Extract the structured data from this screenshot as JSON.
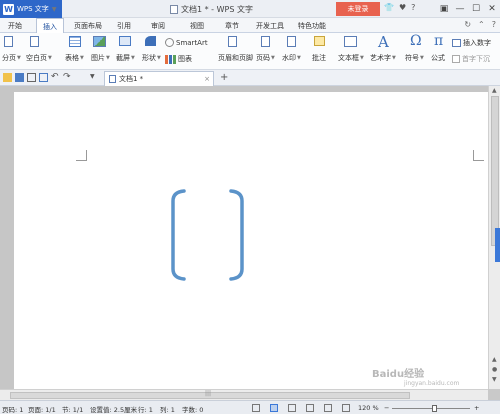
{
  "titlebar": {
    "app_name": "WPS 文字",
    "doc_title": "文档1 * - WPS 文字",
    "login_label": "未登录",
    "icons": [
      "shirt-icon",
      "heart-icon",
      "help-icon",
      "restore-icon",
      "minimize-icon",
      "maximize-icon",
      "close-icon"
    ]
  },
  "menu": {
    "tabs": [
      "开始",
      "插入",
      "页面布局",
      "引用",
      "审阅",
      "视图",
      "章节",
      "开发工具",
      "特色功能"
    ],
    "active": "插入"
  },
  "ribbon": {
    "page_break": "分页",
    "blank_page": "空白页",
    "table": "表格",
    "picture": "图片",
    "screenshot": "截屏",
    "shape": "形状",
    "smartart": "SmartArt",
    "chart": "图表",
    "header_footer": "页眉和页脚",
    "page_number": "页码",
    "watermark": "水印",
    "comment": "批注",
    "textbox": "文本框",
    "wordart": "艺术字",
    "symbol": "符号",
    "formula": "公式",
    "insert_number": "插入数字",
    "dropcap": "首字下沉",
    "symbol_glyph": "Ω",
    "formula_glyph": "π",
    "wordart_glyph": "A"
  },
  "qat": {
    "doc_tab": "文档1 *",
    "add_tab": "+",
    "icons": [
      "open-icon",
      "save-icon",
      "print-icon",
      "preview-icon",
      "undo-icon",
      "redo-icon",
      "customize-icon"
    ]
  },
  "statusbar": {
    "page": "页码: 1",
    "pages": "页面: 1/1",
    "section": "节: 1/1",
    "setting": "设置值: 2.5厘米",
    "row": "行: 1",
    "col": "列: 1",
    "words": "字数: 0",
    "zoom": "120 %",
    "zoom_level": 0.55,
    "zoom_minus": "−",
    "zoom_plus": "+"
  },
  "watermark": {
    "main": "Baidu经验",
    "sub": "jingyan.baidu.com"
  },
  "colors": {
    "accent": "#2e67c9",
    "login": "#e8624f",
    "bracket": "#5b93c9"
  }
}
